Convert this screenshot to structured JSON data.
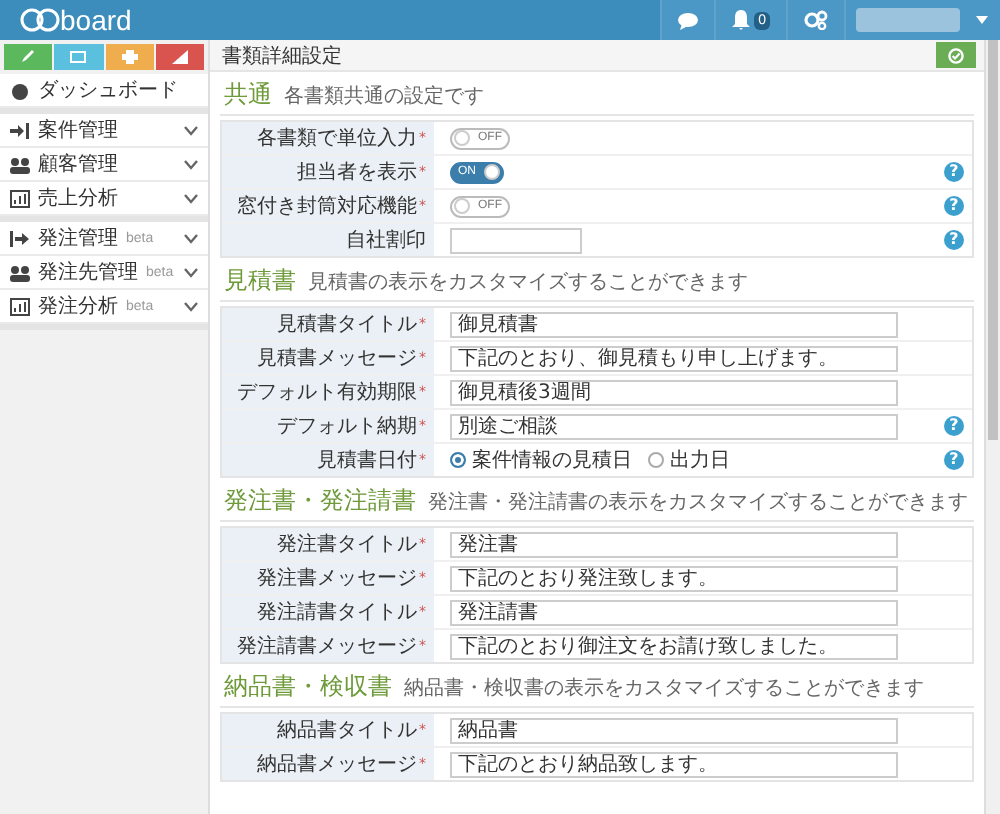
{
  "header": {
    "logo": "board",
    "notifications": "0"
  },
  "sidebar": {
    "quick_buttons": [
      {
        "color": "#5cb85c"
      },
      {
        "color": "#5bc0de"
      },
      {
        "color": "#f0ad4e"
      },
      {
        "color": "#d9534f"
      }
    ],
    "groups": [
      [
        {
          "label": "ダッシュボード"
        }
      ],
      [
        {
          "label": "案件管理"
        },
        {
          "label": "顧客管理"
        },
        {
          "label": "売上分析"
        }
      ],
      [
        {
          "label": "発注管理",
          "badge": "beta"
        },
        {
          "label": "発注先管理",
          "badge": "beta"
        },
        {
          "label": "発注分析",
          "badge": "beta"
        }
      ]
    ]
  },
  "page_title": "書類詳細設定",
  "sections": [
    {
      "title": "共通",
      "subtitle": "各書類共通の設定です",
      "rows": [
        {
          "kind": "toggle",
          "label": "各書類で単位入力",
          "mark": "*",
          "on": false,
          "toggle_text": "OFF"
        },
        {
          "kind": "toggle",
          "label": "担当者を表示",
          "mark": "*",
          "on": true,
          "toggle_text": "ON",
          "help": "?"
        },
        {
          "kind": "toggle",
          "label": "窓付き封筒対応機能",
          "mark": "*",
          "on": false,
          "toggle_text": "OFF",
          "help": "?"
        },
        {
          "kind": "input",
          "label": "自社割印",
          "help": "?"
        }
      ]
    },
    {
      "title": "見積書",
      "subtitle": "見積書の表示をカスタマイズすることができます",
      "rows": [
        {
          "kind": "input",
          "label": "見積書タイトル",
          "mark": "*",
          "value": "御見積書"
        },
        {
          "kind": "input",
          "label": "見積書メッセージ",
          "mark": "*",
          "value": "下記のとおり、御見積もり申し上げます。"
        },
        {
          "kind": "input",
          "label": "デフォルト有効期限",
          "mark": "*",
          "value": "御見積後3週間"
        },
        {
          "kind": "input",
          "label": "デフォルト納期",
          "mark": "*",
          "value": "別途ご相談",
          "help": "?"
        },
        {
          "kind": "radio",
          "label": "見積書日付",
          "mark": "*",
          "options": [
            {
              "label": "案件情報の見積日",
              "selected": true
            },
            {
              "label": "出力日",
              "selected": false
            }
          ],
          "help": "?"
        }
      ]
    },
    {
      "title": "発注書・発注請書",
      "subtitle": "発注書・発注請書の表示をカスタマイズすることができます",
      "rows": [
        {
          "kind": "input",
          "label": "発注書タイトル",
          "mark": "*",
          "value": "発注書"
        },
        {
          "kind": "input",
          "label": "発注書メッセージ",
          "mark": "*",
          "value": "下記のとおり発注致します。"
        },
        {
          "kind": "input",
          "label": "発注請書タイトル",
          "mark": "*",
          "value": "発注請書"
        },
        {
          "kind": "input",
          "label": "発注請書メッセージ",
          "mark": "*",
          "value": "下記のとおり御注文をお請け致しました。"
        }
      ]
    },
    {
      "title": "納品書・検収書",
      "subtitle": "納品書・検収書の表示をカスタマイズすることができます",
      "rows": [
        {
          "kind": "input",
          "label": "納品書タイトル",
          "mark": "*",
          "value": "納品書"
        },
        {
          "kind": "input",
          "label": "納品書メッセージ",
          "mark": "*",
          "value": "下記のとおり納品致します。"
        }
      ]
    }
  ]
}
